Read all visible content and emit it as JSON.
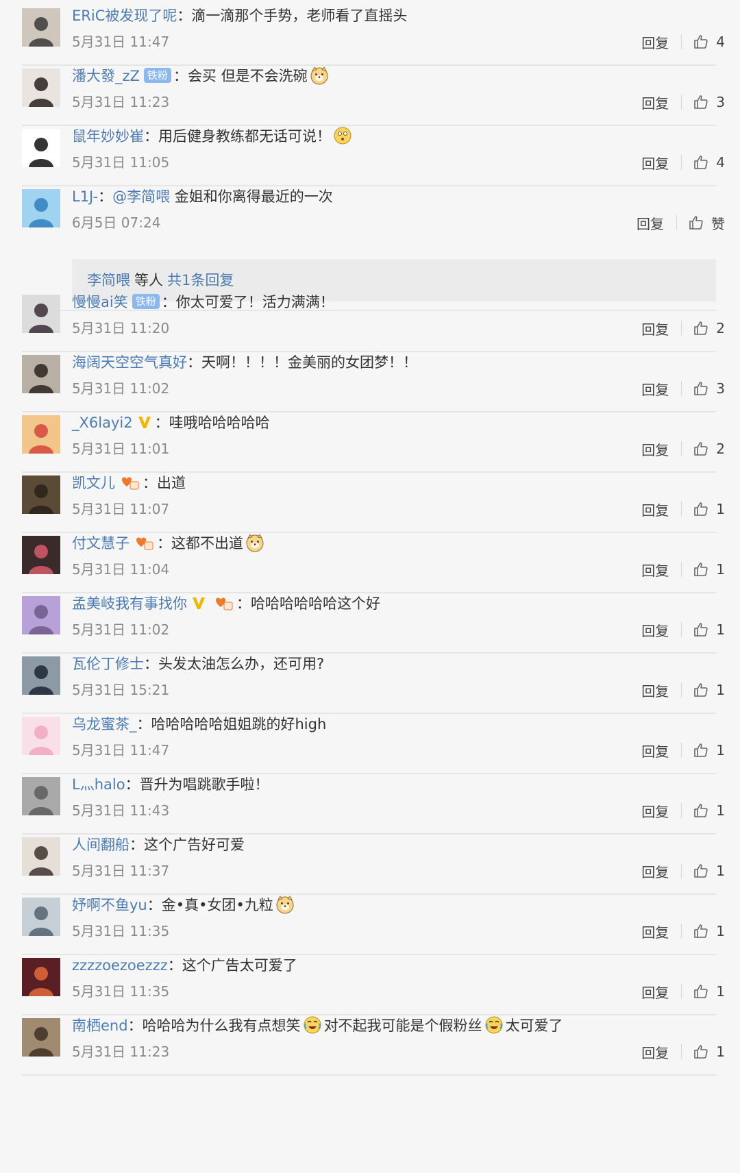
{
  "actions": {
    "reply_label": "回复",
    "like_icon": "thumbs-up-icon",
    "like_empty_label": "赞"
  },
  "colors": {
    "username": "#4c7cb3",
    "badge_bg": "#8ab8ef",
    "vip": "#f5b400",
    "text": "#333333",
    "time": "#8a8a8a"
  },
  "comments": [
    {
      "id": "c1",
      "user": "ERiC被发现了呢",
      "segments": [
        {
          "type": "text",
          "text": "滴一滴那个手势，老师看了直摇头"
        }
      ],
      "time": "5月31日 11:47",
      "likes": "4"
    },
    {
      "id": "c2",
      "user": "潘大發_zZ",
      "badge": "铁粉",
      "segments": [
        {
          "type": "text",
          "text": "会买 但是不会洗碗"
        },
        {
          "type": "emoji",
          "emoji": "doge-emoji"
        }
      ],
      "time": "5月31日 11:23",
      "likes": "3"
    },
    {
      "id": "c3",
      "user": "鼠年妙妙崔",
      "segments": [
        {
          "type": "text",
          "text": "用后健身教练都无话可说！"
        },
        {
          "type": "emoji",
          "emoji": "thinking-emoji"
        }
      ],
      "time": "5月31日 11:05",
      "likes": "4"
    },
    {
      "id": "c4",
      "user": "L1J-",
      "segments": [
        {
          "type": "mention",
          "text": "@李简喂"
        },
        {
          "type": "text",
          "text": " 金姐和你离得最近的一次"
        }
      ],
      "time": "6月5日 07:24",
      "likes": "赞",
      "subreply": {
        "user": "李简喂",
        "middle": "等人",
        "link": "共1条回复"
      }
    },
    {
      "id": "c5",
      "user": "慢慢ai笑",
      "badge": "铁粉",
      "segments": [
        {
          "type": "text",
          "text": "你太可爱了！活力满满！"
        }
      ],
      "time": "5月31日 11:20",
      "likes": "2"
    },
    {
      "id": "c6",
      "user": "海阔天空空气真好",
      "segments": [
        {
          "type": "text",
          "text": "天啊！！！！金美丽的女团梦！！"
        }
      ],
      "time": "5月31日 11:02",
      "likes": "3"
    },
    {
      "id": "c7",
      "user": "_X6layi2",
      "vip": true,
      "segments": [
        {
          "type": "text",
          "text": "哇哦哈哈哈哈哈"
        }
      ],
      "time": "5月31日 11:01",
      "likes": "2"
    },
    {
      "id": "c8",
      "user": "凯文儿",
      "fanbadge": true,
      "segments": [
        {
          "type": "text",
          "text": "出道"
        }
      ],
      "time": "5月31日 11:07",
      "likes": "1"
    },
    {
      "id": "c9",
      "user": "付文慧子",
      "fanbadge": true,
      "segments": [
        {
          "type": "text",
          "text": "这都不出道"
        },
        {
          "type": "emoji",
          "emoji": "doge-emoji"
        }
      ],
      "time": "5月31日 11:04",
      "likes": "1"
    },
    {
      "id": "c10",
      "user": "孟美岐我有事找你",
      "vip": true,
      "fanbadge": true,
      "segments": [
        {
          "type": "text",
          "text": "哈哈哈哈哈哈这个好"
        }
      ],
      "time": "5月31日 11:02",
      "likes": "1"
    },
    {
      "id": "c11",
      "user": "瓦伦丁修士",
      "segments": [
        {
          "type": "text",
          "text": "头发太油怎么办，还可用?"
        }
      ],
      "time": "5月31日 15:21",
      "likes": "1"
    },
    {
      "id": "c12",
      "user": "乌龙蜜茶_",
      "segments": [
        {
          "type": "text",
          "text": "哈哈哈哈哈姐姐跳的好high"
        }
      ],
      "time": "5月31日 11:47",
      "likes": "1"
    },
    {
      "id": "c13",
      "user": "L灬halo",
      "segments": [
        {
          "type": "text",
          "text": "晋升为唱跳歌手啦！"
        }
      ],
      "time": "5月31日 11:43",
      "likes": "1"
    },
    {
      "id": "c14",
      "user": "人间翻船",
      "segments": [
        {
          "type": "text",
          "text": "这个广告好可爱"
        }
      ],
      "time": "5月31日 11:37",
      "likes": "1"
    },
    {
      "id": "c15",
      "user": "妤啊不鱼yu",
      "segments": [
        {
          "type": "text",
          "text": "金•真•女团•九粒"
        },
        {
          "type": "emoji",
          "emoji": "doge-emoji"
        }
      ],
      "time": "5月31日 11:35",
      "likes": "1"
    },
    {
      "id": "c16",
      "user": "zzzzoezoezzz",
      "segments": [
        {
          "type": "text",
          "text": "这个广告太可爱了"
        }
      ],
      "time": "5月31日 11:35",
      "likes": "1"
    },
    {
      "id": "c17",
      "user": "南栖end",
      "segments": [
        {
          "type": "text",
          "text": "哈哈哈为什么我有点想笑"
        },
        {
          "type": "emoji",
          "emoji": "laugh-cry-emoji"
        },
        {
          "type": "text",
          "text": "对不起我可能是个假粉丝"
        },
        {
          "type": "emoji",
          "emoji": "laugh-cry-emoji"
        },
        {
          "type": "text",
          "text": "太可爱了"
        }
      ],
      "time": "5月31日 11:23",
      "likes": "1"
    }
  ]
}
